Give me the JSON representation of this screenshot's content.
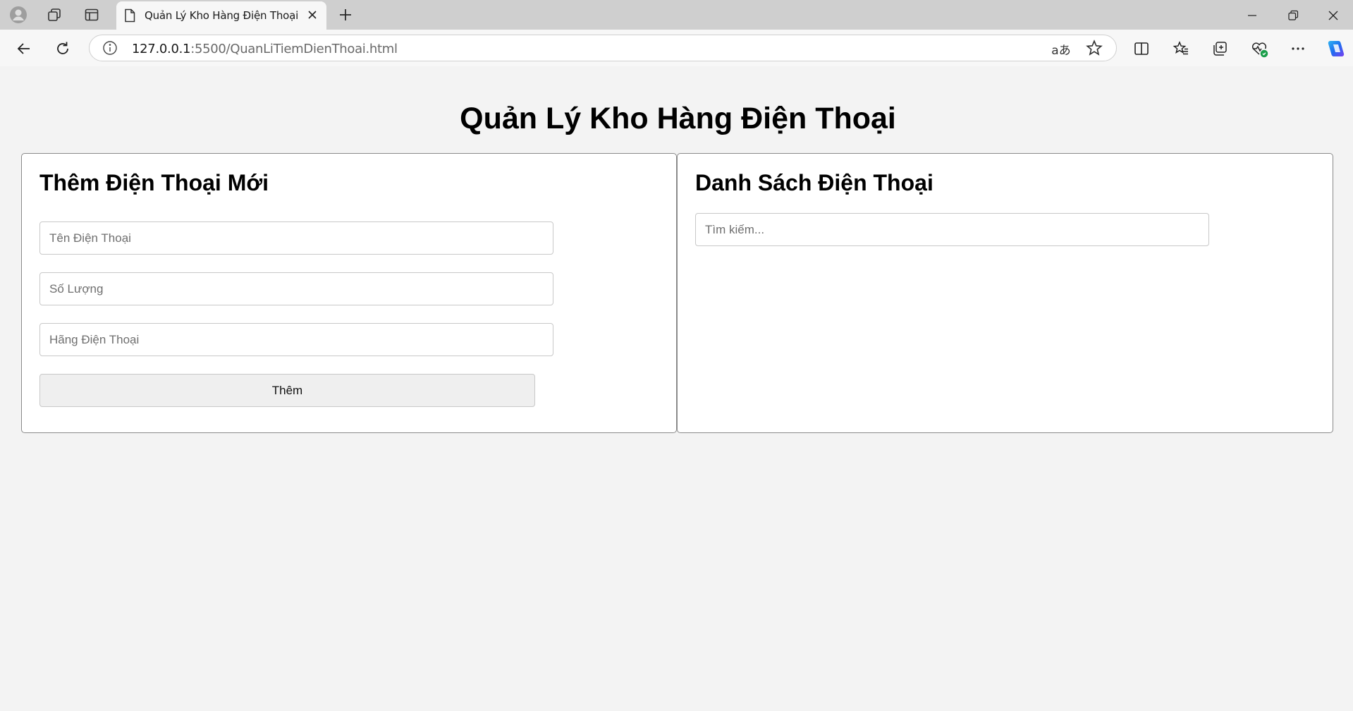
{
  "browser": {
    "tab_title": "Quản Lý Kho Hàng Điện Thoại",
    "url_host": "127.0.0.1",
    "url_rest": ":5500/QuanLiTiemDienThoai.html",
    "read_aloud_label": "aあ"
  },
  "page": {
    "title": "Quản Lý Kho Hàng Điện Thoại",
    "add_panel": {
      "heading": "Thêm Điện Thoại Mới",
      "name_placeholder": "Tên Điện Thoại",
      "quantity_placeholder": "Số Lượng",
      "brand_placeholder": "Hãng Điện Thoại",
      "add_button": "Thêm"
    },
    "list_panel": {
      "heading": "Danh Sách Điện Thoại",
      "search_placeholder": "Tìm kiếm..."
    }
  },
  "icons": {
    "profile": "profile-icon",
    "workspaces": "workspaces-icon",
    "tab_actions": "tab-actions-icon",
    "page": "page-icon",
    "close": "close-icon",
    "new_tab": "plus-icon",
    "back": "back-icon",
    "refresh": "refresh-icon",
    "info": "info-icon",
    "favorite": "star-icon",
    "split": "split-screen-icon",
    "favorites": "favorites-icon",
    "collections": "collections-icon",
    "health": "browser-essentials-icon",
    "more": "more-icon",
    "copilot": "copilot-icon"
  },
  "colors": {
    "page_bg": "#f3f3f3",
    "panel_bg": "#ffffff",
    "copilot_blue": "#1e6cf0"
  }
}
